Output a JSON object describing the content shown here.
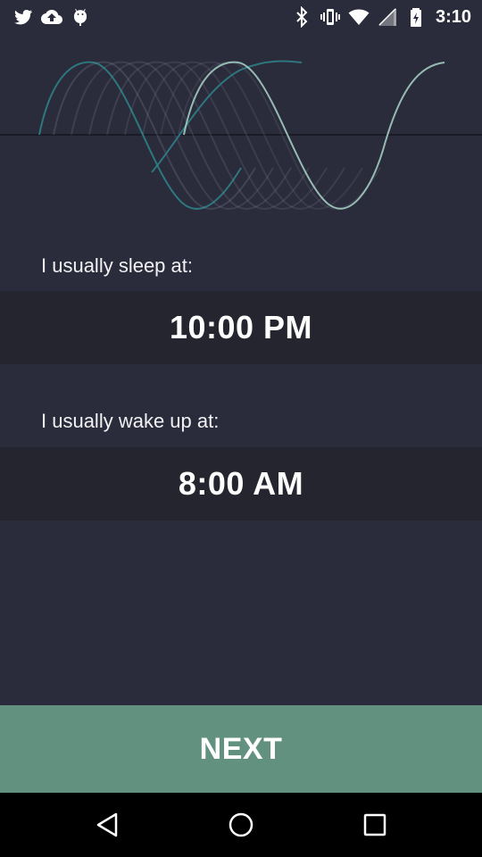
{
  "status_bar": {
    "time": "3:10",
    "left_icons": [
      "twitter-icon",
      "cloud-upload-icon",
      "android-icon"
    ],
    "right_icons": [
      "bluetooth-icon",
      "vibrate-icon",
      "wifi-icon",
      "no-sim-icon",
      "battery-charging-icon"
    ]
  },
  "sleep": {
    "label": "I usually sleep at:",
    "time": "10:00 PM"
  },
  "wake": {
    "label": "I usually wake up at:",
    "time": "8:00 AM"
  },
  "next_button": {
    "label": "NEXT"
  },
  "navigation": {
    "buttons": [
      "back-icon",
      "home-icon",
      "recents-icon"
    ]
  },
  "colors": {
    "background": "#2a2b3b",
    "row_background": "#24252f",
    "accent": "#62917f",
    "wave_teal": "#2f7f86",
    "wave_light": "#a9d3c9"
  }
}
